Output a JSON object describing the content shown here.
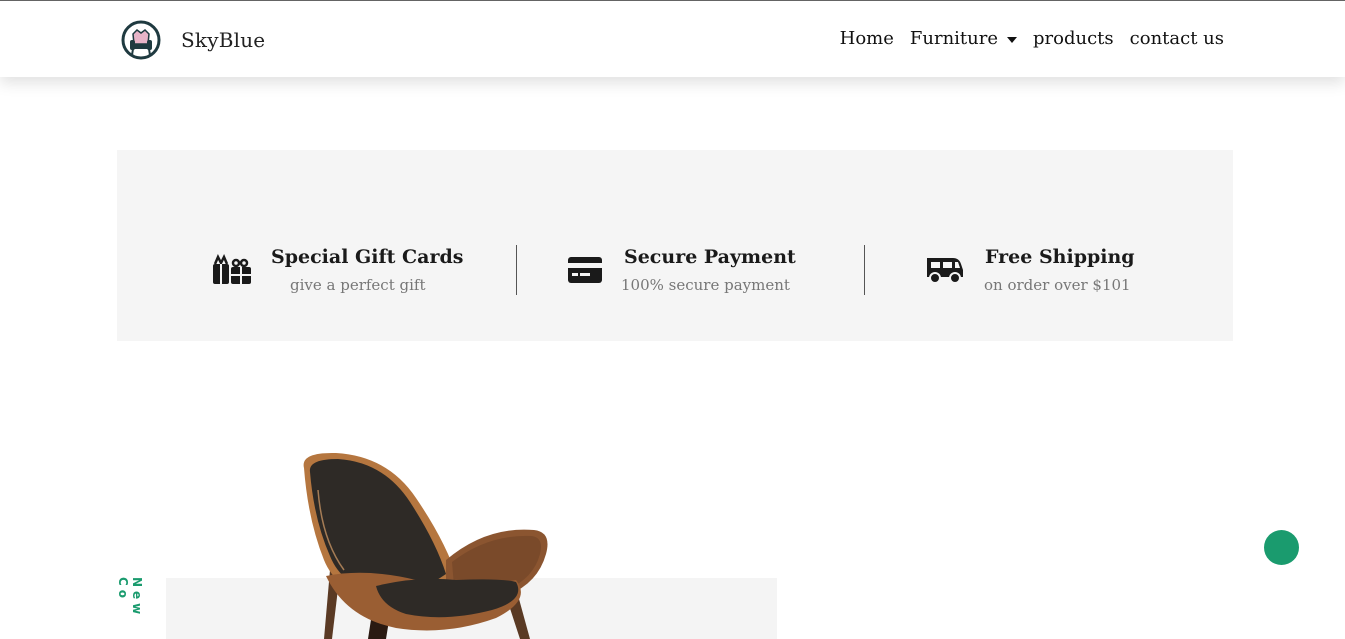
{
  "brand": {
    "name": "SkyBlue",
    "logo_icon": "armchair-logo-icon"
  },
  "nav": {
    "items": [
      {
        "label": "Home"
      },
      {
        "label": "Furniture",
        "dropdown": true
      },
      {
        "label": "products"
      },
      {
        "label": "contact us"
      }
    ]
  },
  "features": [
    {
      "icon": "gift-icon",
      "title": "Special Gift Cards",
      "subtitle": "give a perfect gift"
    },
    {
      "icon": "credit-card-icon",
      "title": "Secure Payment",
      "subtitle": "100% secure payment"
    },
    {
      "icon": "truck-icon",
      "title": "Free Shipping",
      "subtitle": "on order over $101"
    }
  ],
  "hero": {
    "vertical_label": "New Co",
    "image": "lounge-chair-image"
  },
  "colors": {
    "accent": "#1a9b6e",
    "panel": "#f5f5f5"
  }
}
